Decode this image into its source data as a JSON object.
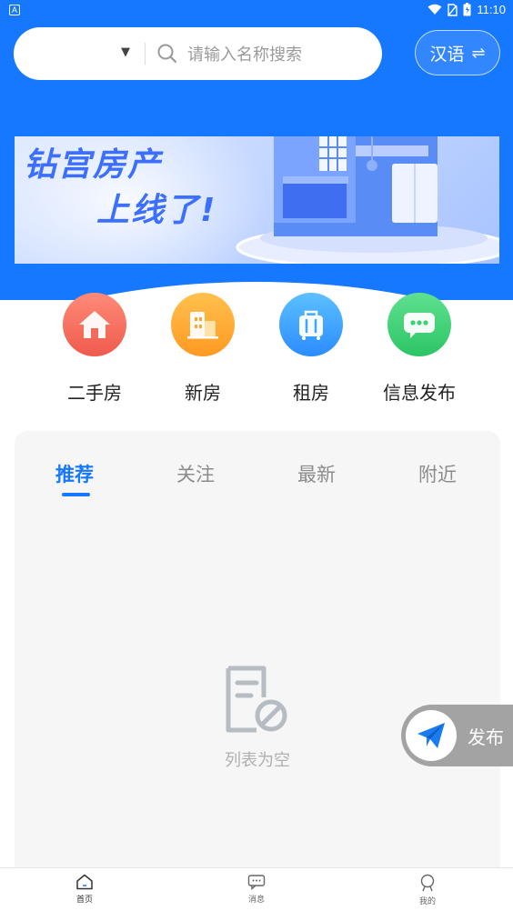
{
  "status_bar": {
    "time": "11:10",
    "left_badge": "A"
  },
  "search": {
    "placeholder": "请输入名称搜索"
  },
  "language": {
    "label": "汉语"
  },
  "banner": {
    "line1": "钻宫房产",
    "line2": "上线了!"
  },
  "categories": [
    {
      "label": "二手房",
      "icon": "house-icon",
      "color": "#f26a5b"
    },
    {
      "label": "新房",
      "icon": "building-icon",
      "color": "#ffa72e"
    },
    {
      "label": "租房",
      "icon": "suitcase-icon",
      "color": "#3fa6ff"
    },
    {
      "label": "信息发布",
      "icon": "chat-icon",
      "color": "#3ccf75"
    }
  ],
  "tabs": [
    {
      "label": "推荐",
      "active": true
    },
    {
      "label": "关注",
      "active": false
    },
    {
      "label": "最新",
      "active": false
    },
    {
      "label": "附近",
      "active": false
    }
  ],
  "empty_state": {
    "text": "列表为空"
  },
  "fab": {
    "label": "发布"
  },
  "bottom_nav": [
    {
      "label": "首页",
      "icon": "home-icon",
      "active": true
    },
    {
      "label": "消息",
      "icon": "message-icon",
      "active": false
    },
    {
      "label": "我的",
      "icon": "profile-icon",
      "active": false
    }
  ],
  "colors": {
    "primary": "#1677ff",
    "card_bg": "#f6f6f6",
    "fab_bg": "#a3a3a3"
  }
}
